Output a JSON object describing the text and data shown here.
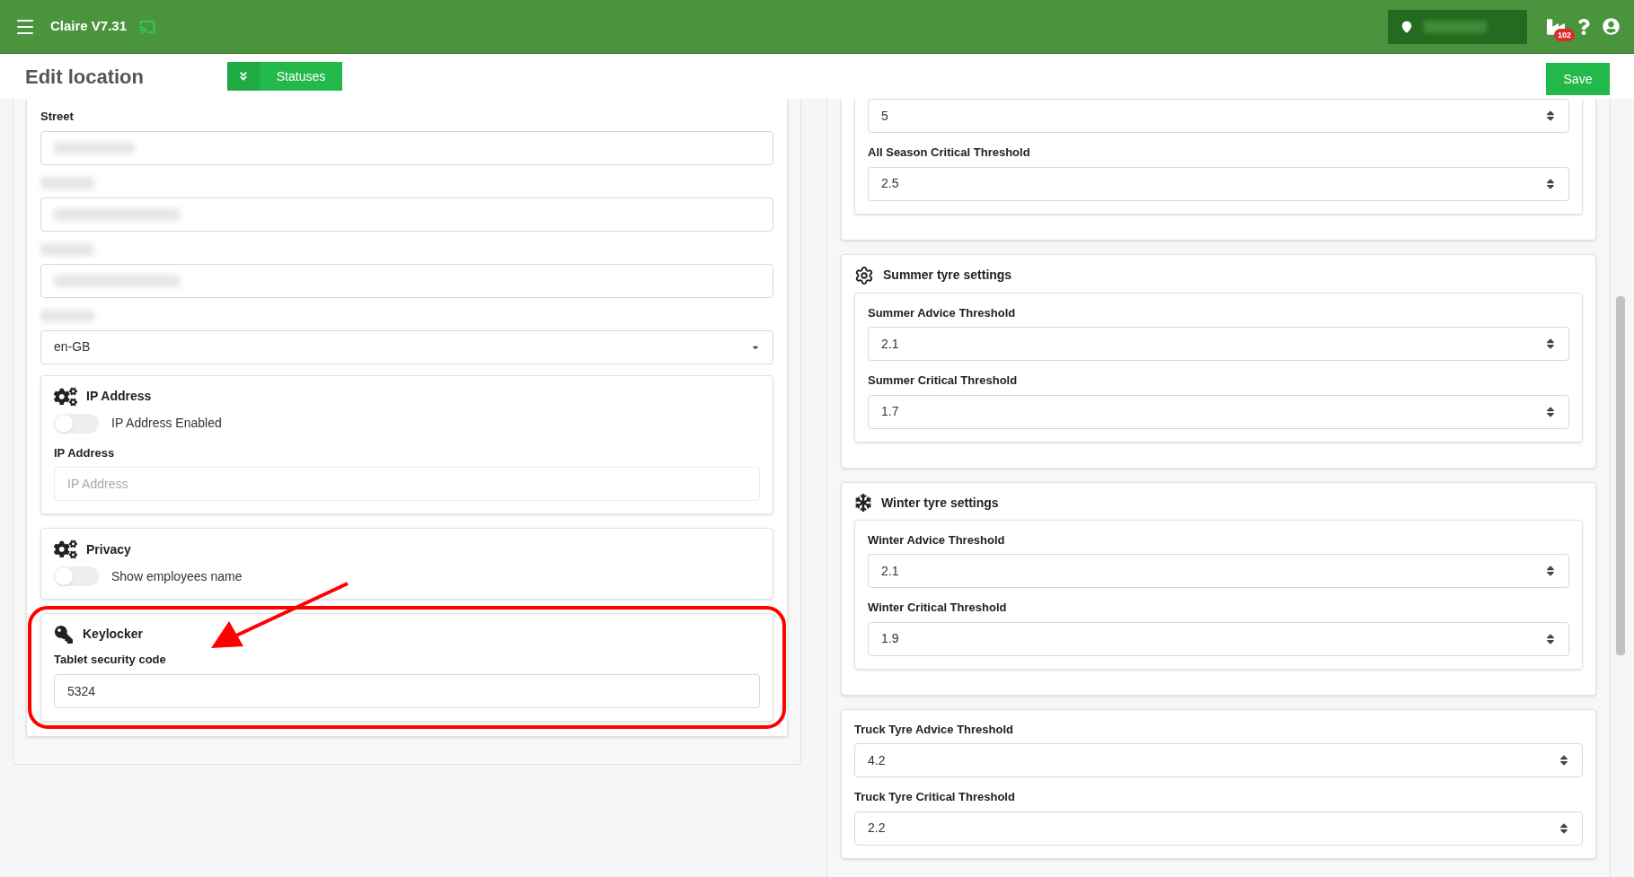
{
  "header": {
    "title": "Claire V7.31",
    "notification_count": "102"
  },
  "page": {
    "title": "Edit location",
    "statuses_button": "Statuses",
    "save_button": "Save"
  },
  "address_fields": [
    {
      "kind": "text",
      "label": "Street",
      "value_blurred": true
    },
    {
      "kind": "blurred"
    },
    {
      "kind": "blurred"
    },
    {
      "kind": "select",
      "value": "en-GB"
    }
  ],
  "ip_card": {
    "title": "IP Address",
    "toggle": {
      "label": "IP Address Enabled",
      "on": false
    },
    "field": {
      "label": "IP Address",
      "placeholder": "IP Address"
    }
  },
  "privacy_card": {
    "title": "Privacy",
    "toggle": {
      "label": "Show employees name",
      "on": false
    }
  },
  "keylocker_card": {
    "title": "Keylocker",
    "field": {
      "label": "Tablet security code",
      "value": "5324"
    }
  },
  "tyre_sections": [
    {
      "kind": "continued",
      "fields": [
        {
          "value": "5"
        },
        {
          "label": "All Season Critical Threshold",
          "value": "2.5"
        }
      ]
    },
    {
      "kind": "titled",
      "title": "Summer tyre settings",
      "fields": [
        {
          "label": "Summer Advice Threshold",
          "value": "2.1"
        },
        {
          "label": "Summer Critical Threshold",
          "value": "1.7"
        }
      ]
    },
    {
      "kind": "titled",
      "title": "Winter tyre settings",
      "fields": [
        {
          "label": "Winter Advice Threshold",
          "value": "2.1"
        },
        {
          "label": "Winter Critical Threshold",
          "value": "1.9"
        }
      ]
    },
    {
      "kind": "flat",
      "fields": [
        {
          "label": "Truck Tyre Advice Threshold",
          "value": "4.2"
        },
        {
          "label": "Truck Tyre Critical Threshold",
          "value": "2.2"
        }
      ]
    }
  ]
}
